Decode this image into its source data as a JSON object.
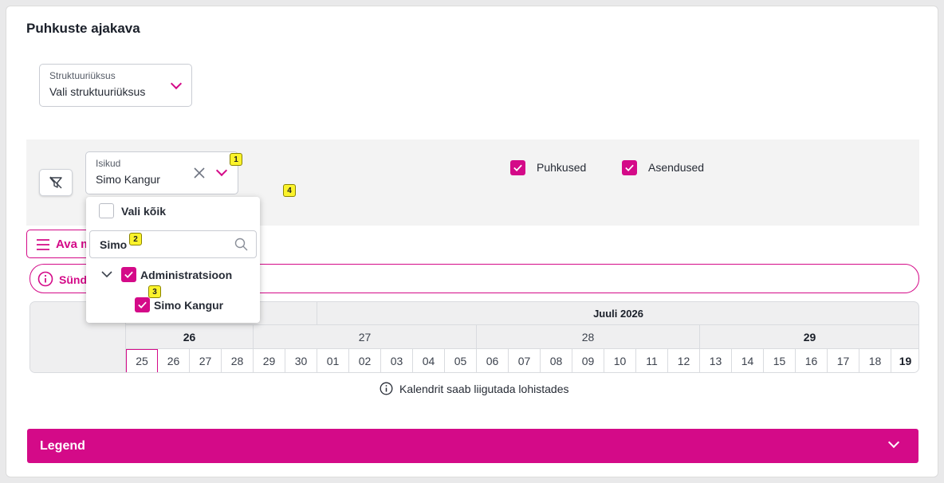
{
  "page": {
    "title": "Puhkuste ajakava"
  },
  "unit_select": {
    "label": "Struktuuriüksus",
    "placeholder": "Vali struktuuriüksus"
  },
  "persons_select": {
    "label": "Isikud",
    "value": "Simo Kangur"
  },
  "toggles": [
    {
      "label": "Puhkused",
      "checked": true
    },
    {
      "label": "Asendused",
      "checked": true
    }
  ],
  "dropdown": {
    "select_all_label": "Vali kõik",
    "search_value": "Simo",
    "group_label": "Administratsioon",
    "person_label": "Simo Kangur"
  },
  "open_button": {
    "label": "Ava m"
  },
  "notice": {
    "text": "Sünd"
  },
  "badges": [
    "1",
    "2",
    "3",
    "4"
  ],
  "calendar": {
    "month": "Juuli 2026",
    "weeks": [
      "26",
      "27",
      "28",
      "29"
    ],
    "days": [
      "25",
      "26",
      "27",
      "28",
      "29",
      "30",
      "01",
      "02",
      "03",
      "04",
      "05",
      "06",
      "07",
      "08",
      "09",
      "10",
      "11",
      "12",
      "13",
      "14",
      "15",
      "16",
      "17",
      "18",
      "19"
    ],
    "today_day": "25",
    "bold_day": "19"
  },
  "hint": {
    "text": "Kalendrit saab liigutada lohistades"
  },
  "legend": {
    "title": "Legend"
  },
  "colors": {
    "accent": "#d40a88",
    "badge": "#fbf32b"
  },
  "icons": {
    "filter": "filter-off-icon",
    "search": "search-icon",
    "info": "info-icon",
    "clear": "close-icon",
    "menu": "menu-icon"
  }
}
